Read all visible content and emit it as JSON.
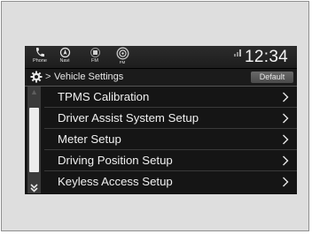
{
  "statusbar": {
    "icons": [
      {
        "icon": "phone-icon",
        "label": "Phone"
      },
      {
        "icon": "navi-icon",
        "label": "Navi"
      },
      {
        "icon": "radio-icon",
        "label": "FM"
      },
      {
        "icon": "audio-source-icon",
        "label": "FM"
      }
    ],
    "clock": "12:34"
  },
  "header": {
    "icon": "gear-icon",
    "separator": ">",
    "title": "Vehicle Settings",
    "default_label": "Default"
  },
  "list": {
    "items": [
      {
        "label": "TPMS Calibration"
      },
      {
        "label": "Driver Assist System Setup"
      },
      {
        "label": "Meter Setup"
      },
      {
        "label": "Driving Position Setup"
      },
      {
        "label": "Keyless Access Setup"
      }
    ]
  },
  "colors": {
    "screen_bg": "#151515",
    "text": "#f0f0f0",
    "default_button": "#5a5a5a"
  }
}
